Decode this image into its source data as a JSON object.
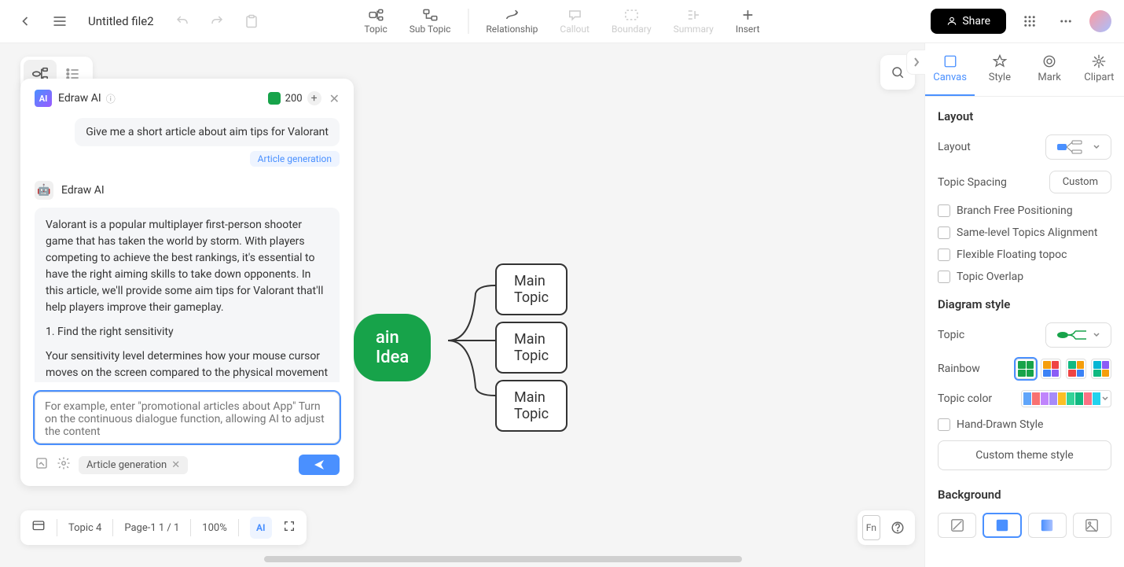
{
  "topbar": {
    "file_title": "Untitled file2",
    "tools": {
      "topic": "Topic",
      "sub_topic": "Sub Topic",
      "relationship": "Relationship",
      "callout": "Callout",
      "boundary": "Boundary",
      "summary": "Summary",
      "insert": "Insert"
    },
    "share": "Share"
  },
  "ai_panel": {
    "title": "Edraw AI",
    "credits": "200",
    "user_message": "Give me a short article about aim tips for Valorant",
    "user_tag": "Article generation",
    "bot_name": "Edraw AI",
    "bot_p1": "Valorant is a popular multiplayer first-person shooter game that has taken the world by storm. With players competing to achieve the best rankings, it's essential to have the right aiming skills to take down opponents. In this article, we'll provide some aim tips for Valorant that'll help players improve their gameplay.",
    "bot_p2": "1. Find the right sensitivity",
    "bot_p3": "Your sensitivity level determines how your mouse cursor moves on the screen compared to the physical movement of your hand. Therefore, it's essent",
    "input_placeholder": "For example, enter \"promotional articles about App\" Turn on the continuous dialogue function, allowing AI to adjust the content",
    "chip": "Article generation"
  },
  "mindmap": {
    "root": "ain Idea",
    "children": [
      "Main Topic",
      "Main Topic",
      "Main Topic"
    ]
  },
  "right_panel": {
    "tabs": {
      "canvas": "Canvas",
      "style": "Style",
      "mark": "Mark",
      "clipart": "Clipart"
    },
    "layout_title": "Layout",
    "layout_label": "Layout",
    "spacing_label": "Topic Spacing",
    "custom": "Custom",
    "branch_free": "Branch Free Positioning",
    "same_level": "Same-level Topics Alignment",
    "flex_float": "Flexible Floating topoc",
    "overlap": "Topic Overlap",
    "diagram_title": "Diagram style",
    "topic_label": "Topic",
    "rainbow_label": "Rainbow",
    "topic_color_label": "Topic color",
    "hand_drawn": "Hand-Drawn Style",
    "custom_theme": "Custom theme style",
    "background_title": "Background"
  },
  "bottom_bar": {
    "topic_count": "Topic 4",
    "page": "Page-1  1 / 1",
    "zoom": "100%",
    "fn": "Fn"
  },
  "colors": {
    "primary": "#4a90ff",
    "green": "#17a34a"
  }
}
